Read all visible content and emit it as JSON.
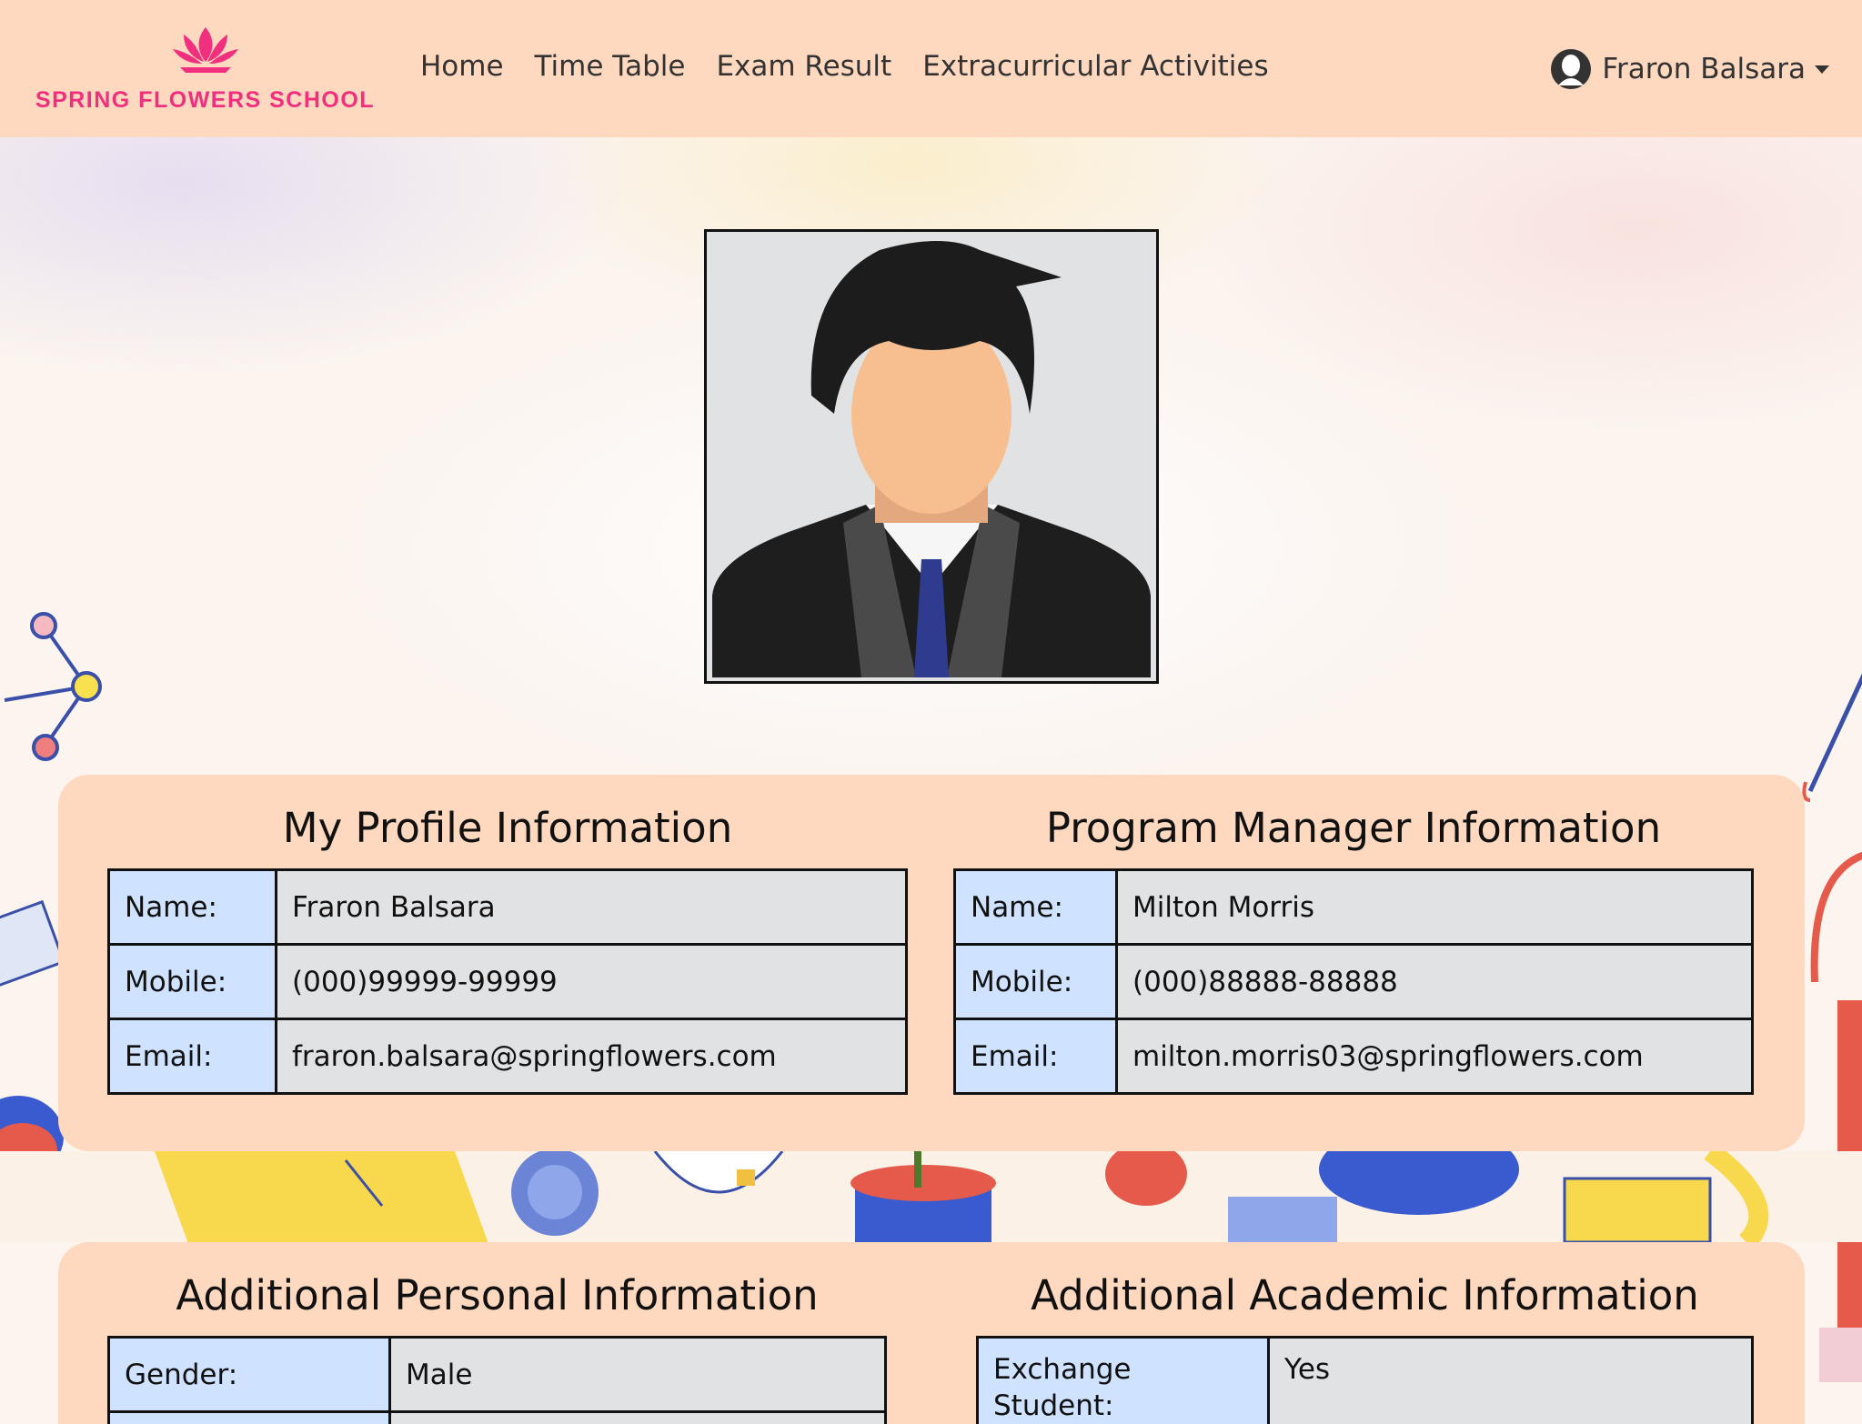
{
  "brand": {
    "name": "SPRING FLOWERS SCHOOL",
    "color": "#f0307e"
  },
  "nav": {
    "links": [
      {
        "label": "Home"
      },
      {
        "label": "Time Table"
      },
      {
        "label": "Exam Result"
      },
      {
        "label": "Extracurricular Activities"
      }
    ],
    "user": {
      "name": "Fraron Balsara",
      "icon": "user-circle-icon"
    }
  },
  "profile_photo": {
    "icon": "person-avatar-icon"
  },
  "my_profile": {
    "title": "My Profile Information",
    "rows": [
      {
        "label": "Name:",
        "value": "Fraron Balsara"
      },
      {
        "label": "Mobile:",
        "value": "(000)99999-99999"
      },
      {
        "label": "Email:",
        "value": "fraron.balsara@springflowers.com"
      }
    ]
  },
  "program_manager": {
    "title": "Program Manager Information",
    "rows": [
      {
        "label": "Name:",
        "value": "Milton Morris"
      },
      {
        "label": "Mobile:",
        "value": "(000)88888-88888"
      },
      {
        "label": "Email:",
        "value": "milton.morris03@springflowers.com"
      }
    ]
  },
  "additional_personal": {
    "title": "Additional Personal Information",
    "rows": [
      {
        "label": "Gender:",
        "value": "Male"
      },
      {
        "label": "",
        "value": ""
      }
    ]
  },
  "additional_academic": {
    "title": "Additional Academic Information",
    "rows": [
      {
        "label": "Exchange Student:",
        "value": "Yes"
      }
    ]
  },
  "colors": {
    "navbar": "#ffd8c0",
    "card": "#ffd8c0",
    "label_cell": "#cfe2ff",
    "value_cell": "#e1e2e4"
  }
}
